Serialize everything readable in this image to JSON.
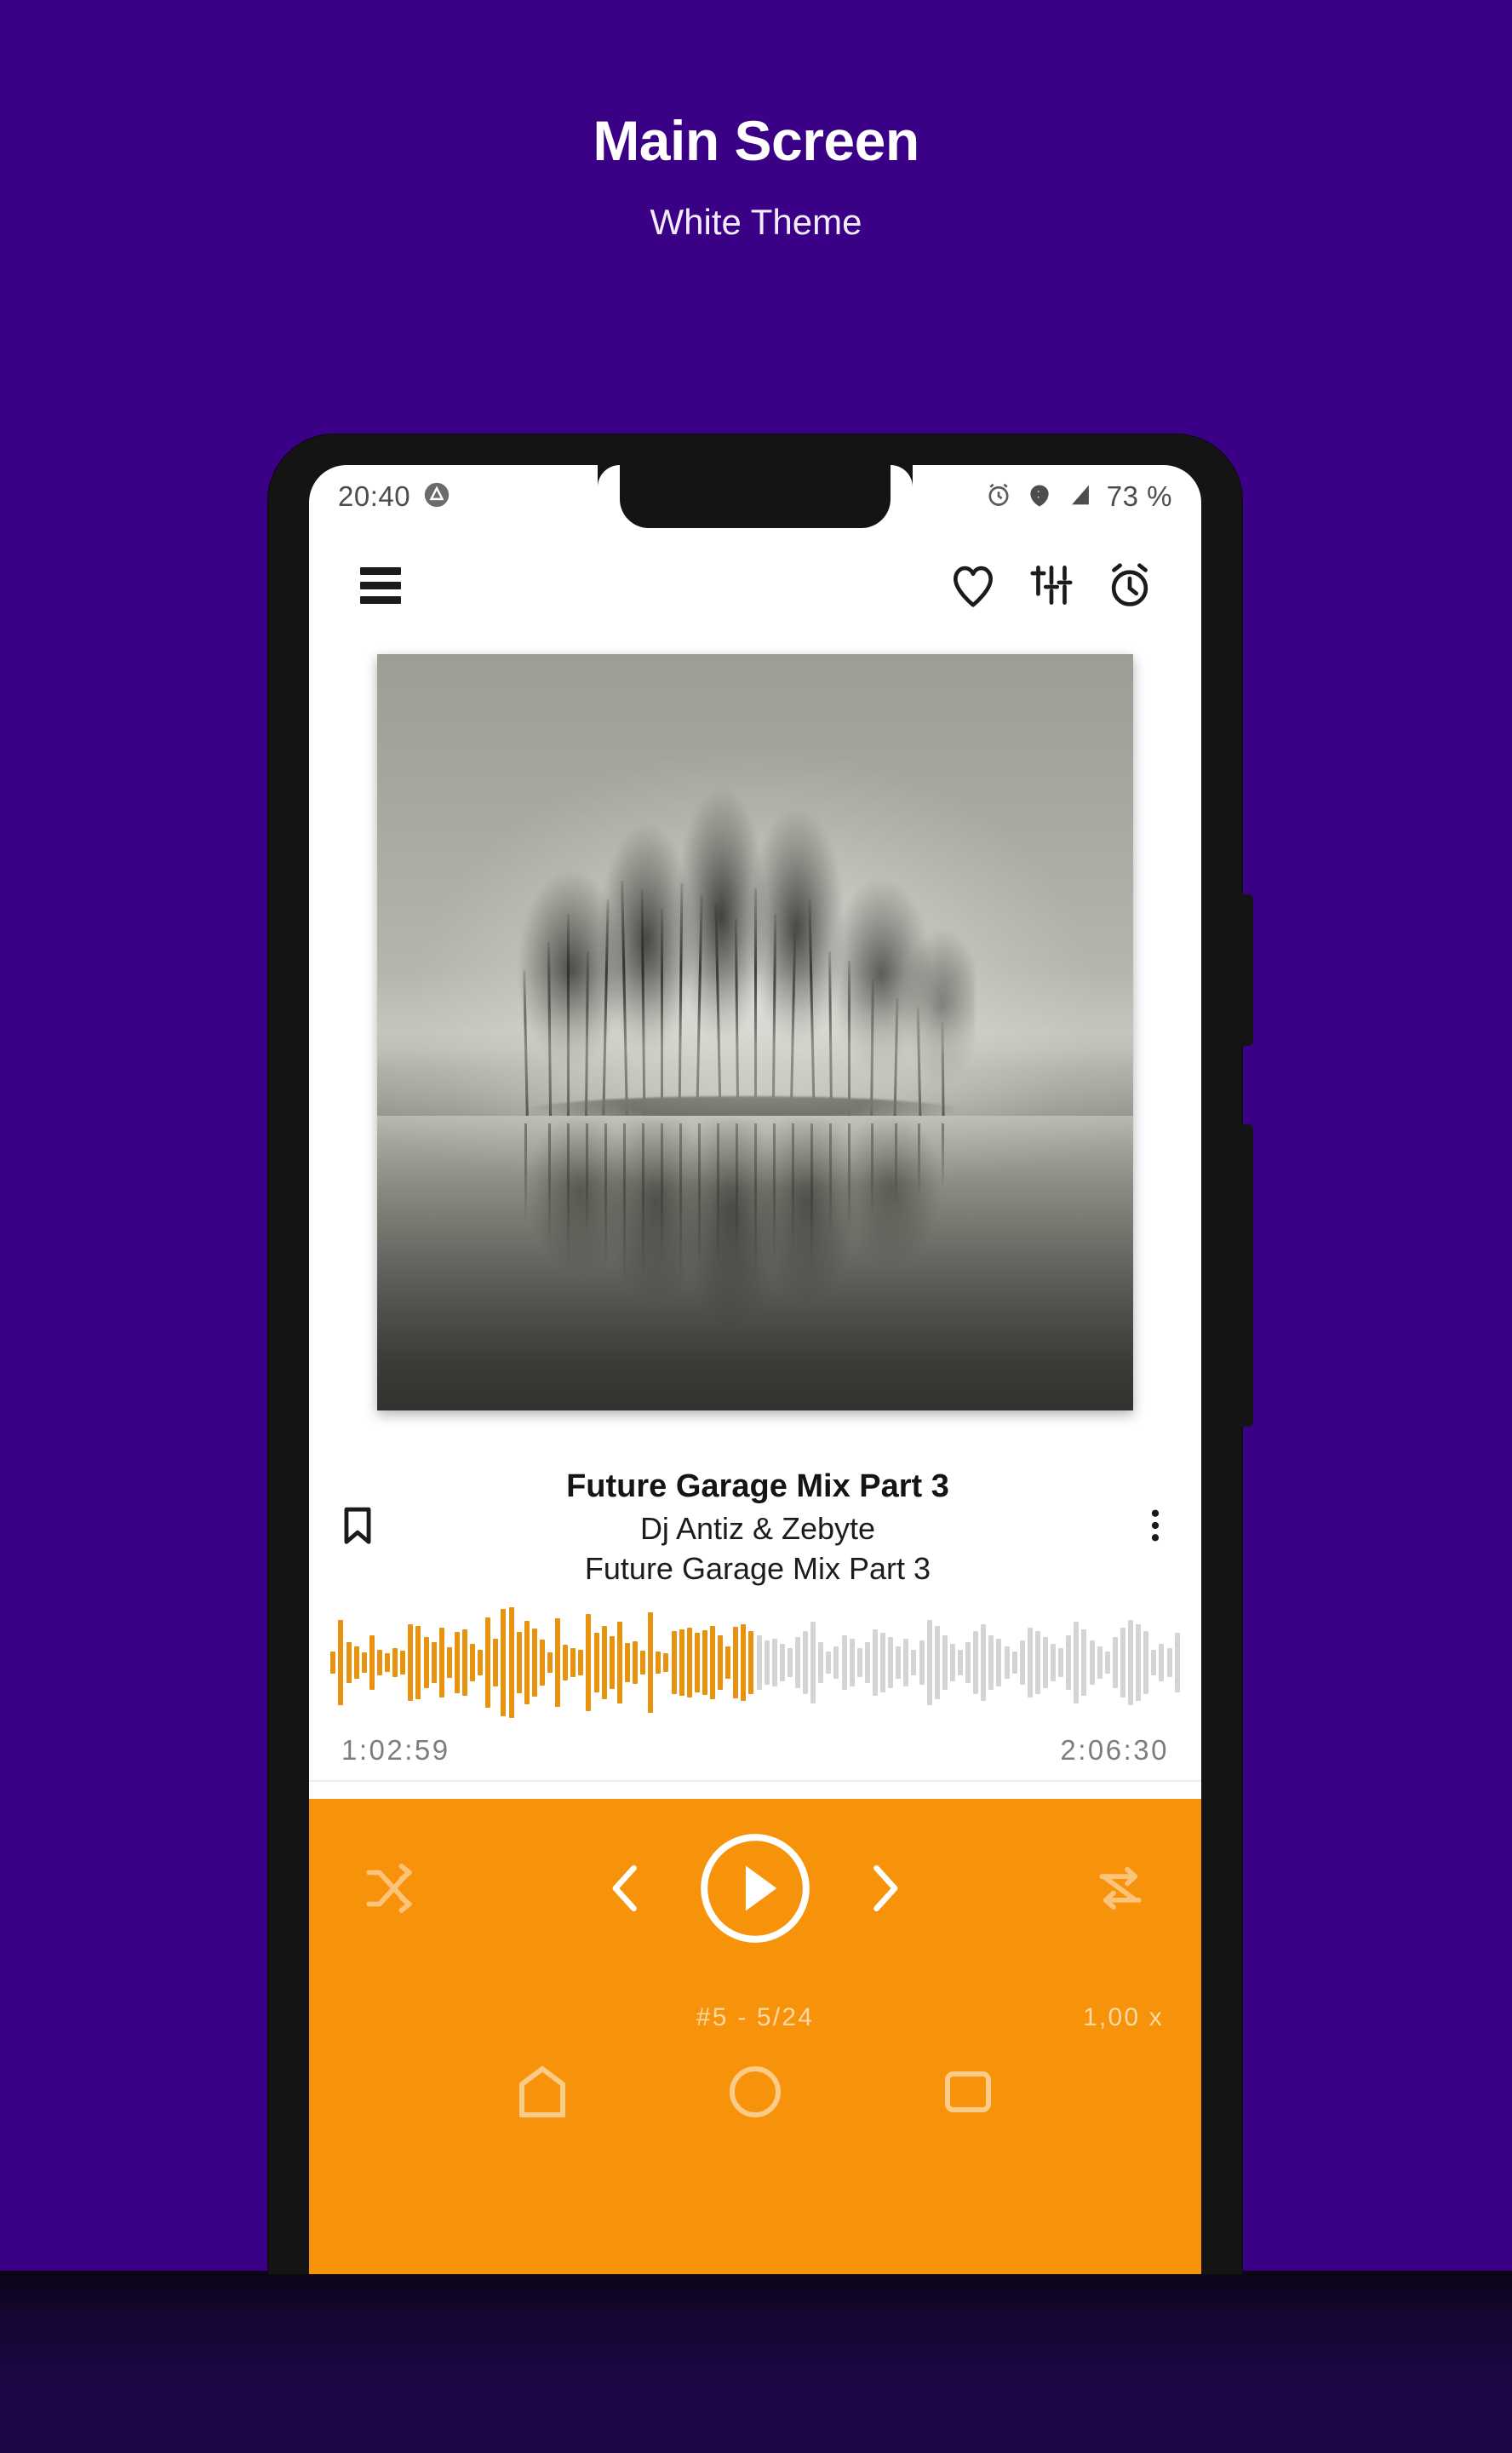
{
  "promo": {
    "title": "Main Screen",
    "subtitle": "White Theme",
    "background_color": "#3a0085"
  },
  "phone": {
    "frame_color": "#141414",
    "screen_background": "#ffffff"
  },
  "status_bar": {
    "time": "20:40",
    "app_icon": "triangle-badge-icon",
    "alarm_icon": "alarm-clock-icon",
    "wifi_icon": "wifi-icon",
    "signal_icon": "cell-signal-icon",
    "battery": "73 %"
  },
  "toolbar": {
    "menu_icon": "hamburger-menu-icon",
    "favorite_icon": "heart-outline-icon",
    "equalizer_icon": "equalizer-sliders-icon",
    "sleep_timer_icon": "alarm-clock-icon"
  },
  "album_art": {
    "description": "black-and-white misty lake with island of trees reflected in water"
  },
  "track": {
    "title": "Future Garage Mix Part 3",
    "artist": "Dj Antiz & Zebyte",
    "album": "Future Garage Mix Part 3",
    "bookmark_icon": "bookmark-outline-icon",
    "overflow_icon": "more-vertical-icon"
  },
  "progress": {
    "elapsed": "1:02:59",
    "total": "2:06:30",
    "played_fraction": 0.498,
    "played_color": "#e8930f",
    "remaining_color": "#d4d4d4",
    "bar_heights": [
      12,
      46,
      22,
      18,
      11,
      30,
      14,
      10,
      16,
      13,
      42,
      40,
      28,
      22,
      38,
      17,
      33,
      36,
      20,
      14,
      49,
      26,
      58,
      60,
      33,
      45,
      37,
      25,
      11,
      48,
      19,
      16,
      14,
      53,
      32,
      40,
      29,
      44,
      21,
      23,
      13,
      55,
      12,
      10,
      34,
      36,
      38,
      32,
      35,
      40,
      30,
      18,
      39,
      42,
      34,
      30,
      24,
      26,
      20,
      16,
      28,
      34,
      44,
      22,
      12,
      18,
      30,
      26,
      16,
      22,
      36,
      32,
      28,
      18,
      26,
      14,
      24,
      46,
      40,
      30,
      20,
      14,
      22,
      34,
      42,
      30,
      26,
      18,
      12,
      24,
      38,
      34,
      28,
      20,
      16,
      30,
      44,
      36,
      24,
      18,
      12,
      28,
      38,
      46,
      42,
      34,
      14,
      20,
      16,
      32
    ]
  },
  "player_controls": {
    "background_color": "#f7930a",
    "shuffle_icon": "shuffle-icon",
    "previous_icon": "chevron-left-icon",
    "play_icon": "play-circle-icon",
    "next_icon": "chevron-right-icon",
    "repeat_icon": "repeat-icon"
  },
  "player_meta": {
    "queue_position": "#5  -  5/24",
    "playback_speed": "1,00 x"
  }
}
